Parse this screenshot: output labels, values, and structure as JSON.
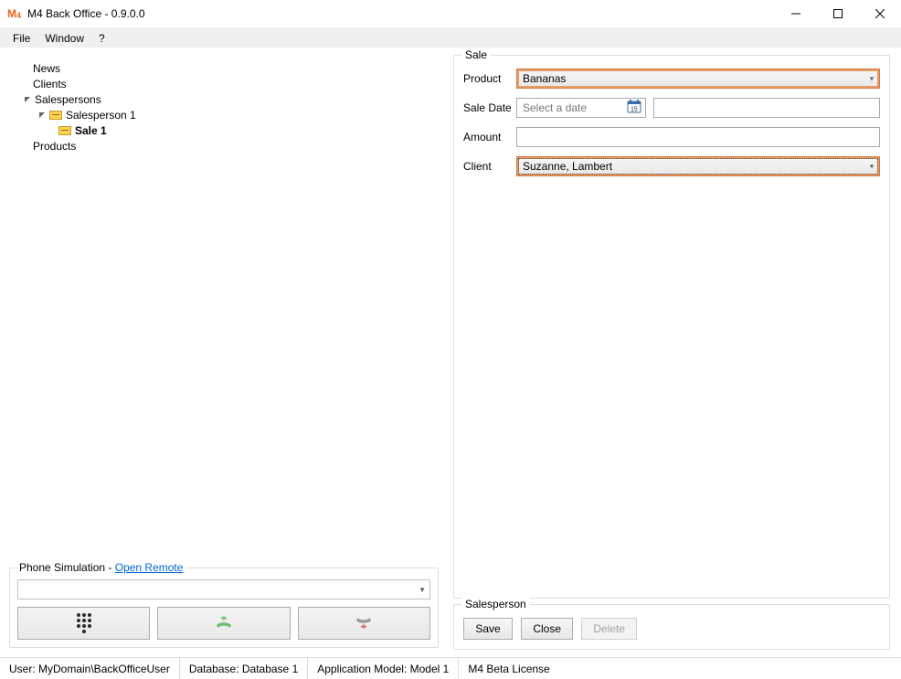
{
  "window": {
    "title": "M4 Back Office - 0.9.0.0"
  },
  "menu": {
    "file": "File",
    "window": "Window",
    "help": "?"
  },
  "tree": {
    "news": "News",
    "clients": "Clients",
    "salespersons": "Salespersons",
    "salesperson1": "Salesperson 1",
    "sale1": "Sale 1",
    "products": "Products"
  },
  "phone": {
    "group_prefix": "Phone Simulation - ",
    "open_remote": "Open Remote"
  },
  "sale": {
    "group": "Sale",
    "product_label": "Product",
    "product_value": "Bananas",
    "saledate_label": "Sale Date",
    "saledate_placeholder": "Select a date",
    "amount_label": "Amount",
    "amount_value": "",
    "client_label": "Client",
    "client_value": "Suzanne, Lambert"
  },
  "salesperson": {
    "group": "Salesperson",
    "save": "Save",
    "close": "Close",
    "delete": "Delete"
  },
  "status": {
    "user": "User: MyDomain\\BackOfficeUser",
    "database": "Database: Database 1",
    "appmodel": "Application Model: Model 1",
    "license": "M4 Beta License"
  }
}
